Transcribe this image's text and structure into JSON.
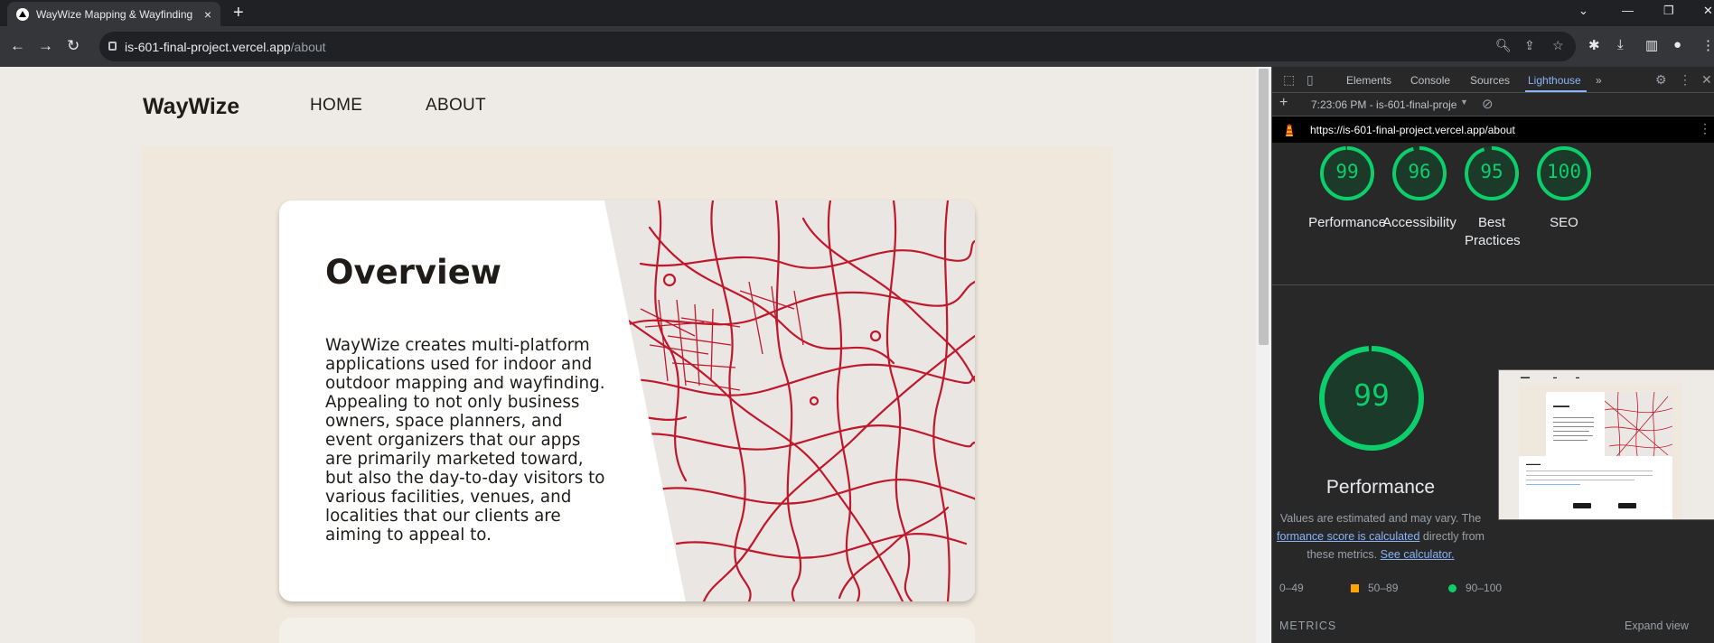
{
  "browser": {
    "tab_title": "WayWize Mapping & Wayfinding",
    "tab_close": "×",
    "new_tab": "+",
    "url_host": "is-601-final-project.vercel.app",
    "url_path": "/about"
  },
  "site": {
    "logo": "WayWize",
    "nav": {
      "home": "HOME",
      "about": "ABOUT"
    },
    "overview": {
      "title": "Overview",
      "text": "WayWize creates multi-platform applications used for indoor and outdoor mapping and wayfinding. Appealing to not only business owners, space planners, and event organizers that our apps are primarily marketed toward, but also the day-to-day visitors to various facilities, venues, and localities that our clients are aiming to appeal to."
    }
  },
  "devtools": {
    "tabs": [
      "Elements",
      "Console",
      "Sources",
      "Lighthouse"
    ],
    "more": "»",
    "run_label": "7:23:06 PM - is-601-final-proje",
    "report_url": "https://is-601-final-project.vercel.app/about",
    "scores": [
      {
        "label": "Performance",
        "value": "99",
        "fraction": 0.99
      },
      {
        "label": "Accessibility",
        "value": "96",
        "fraction": 0.96
      },
      {
        "label": "Best Practices",
        "value": "95",
        "fraction": 0.95
      },
      {
        "label": "SEO",
        "value": "100",
        "fraction": 1.0
      }
    ],
    "performance": {
      "score": "99",
      "title": "Performance",
      "note_lead": "Values are estimated and may vary. The",
      "note_link": "formance score is calculated",
      "note_mid": "directly from these metrics.",
      "note_link2": "See calculator."
    },
    "legend": [
      {
        "label": "0–49",
        "color": "#ff4e42"
      },
      {
        "label": "50–89",
        "color": "#ffa400"
      },
      {
        "label": "90–100",
        "color": "#0cce6b"
      }
    ],
    "metrics_label": "METRICS",
    "expand_label": "Expand view"
  },
  "colors": {
    "pass": "#0cce6b",
    "page_bg": "#eeebe6",
    "content_bg": "#f0e8dc",
    "map_red": "#c0182a"
  }
}
